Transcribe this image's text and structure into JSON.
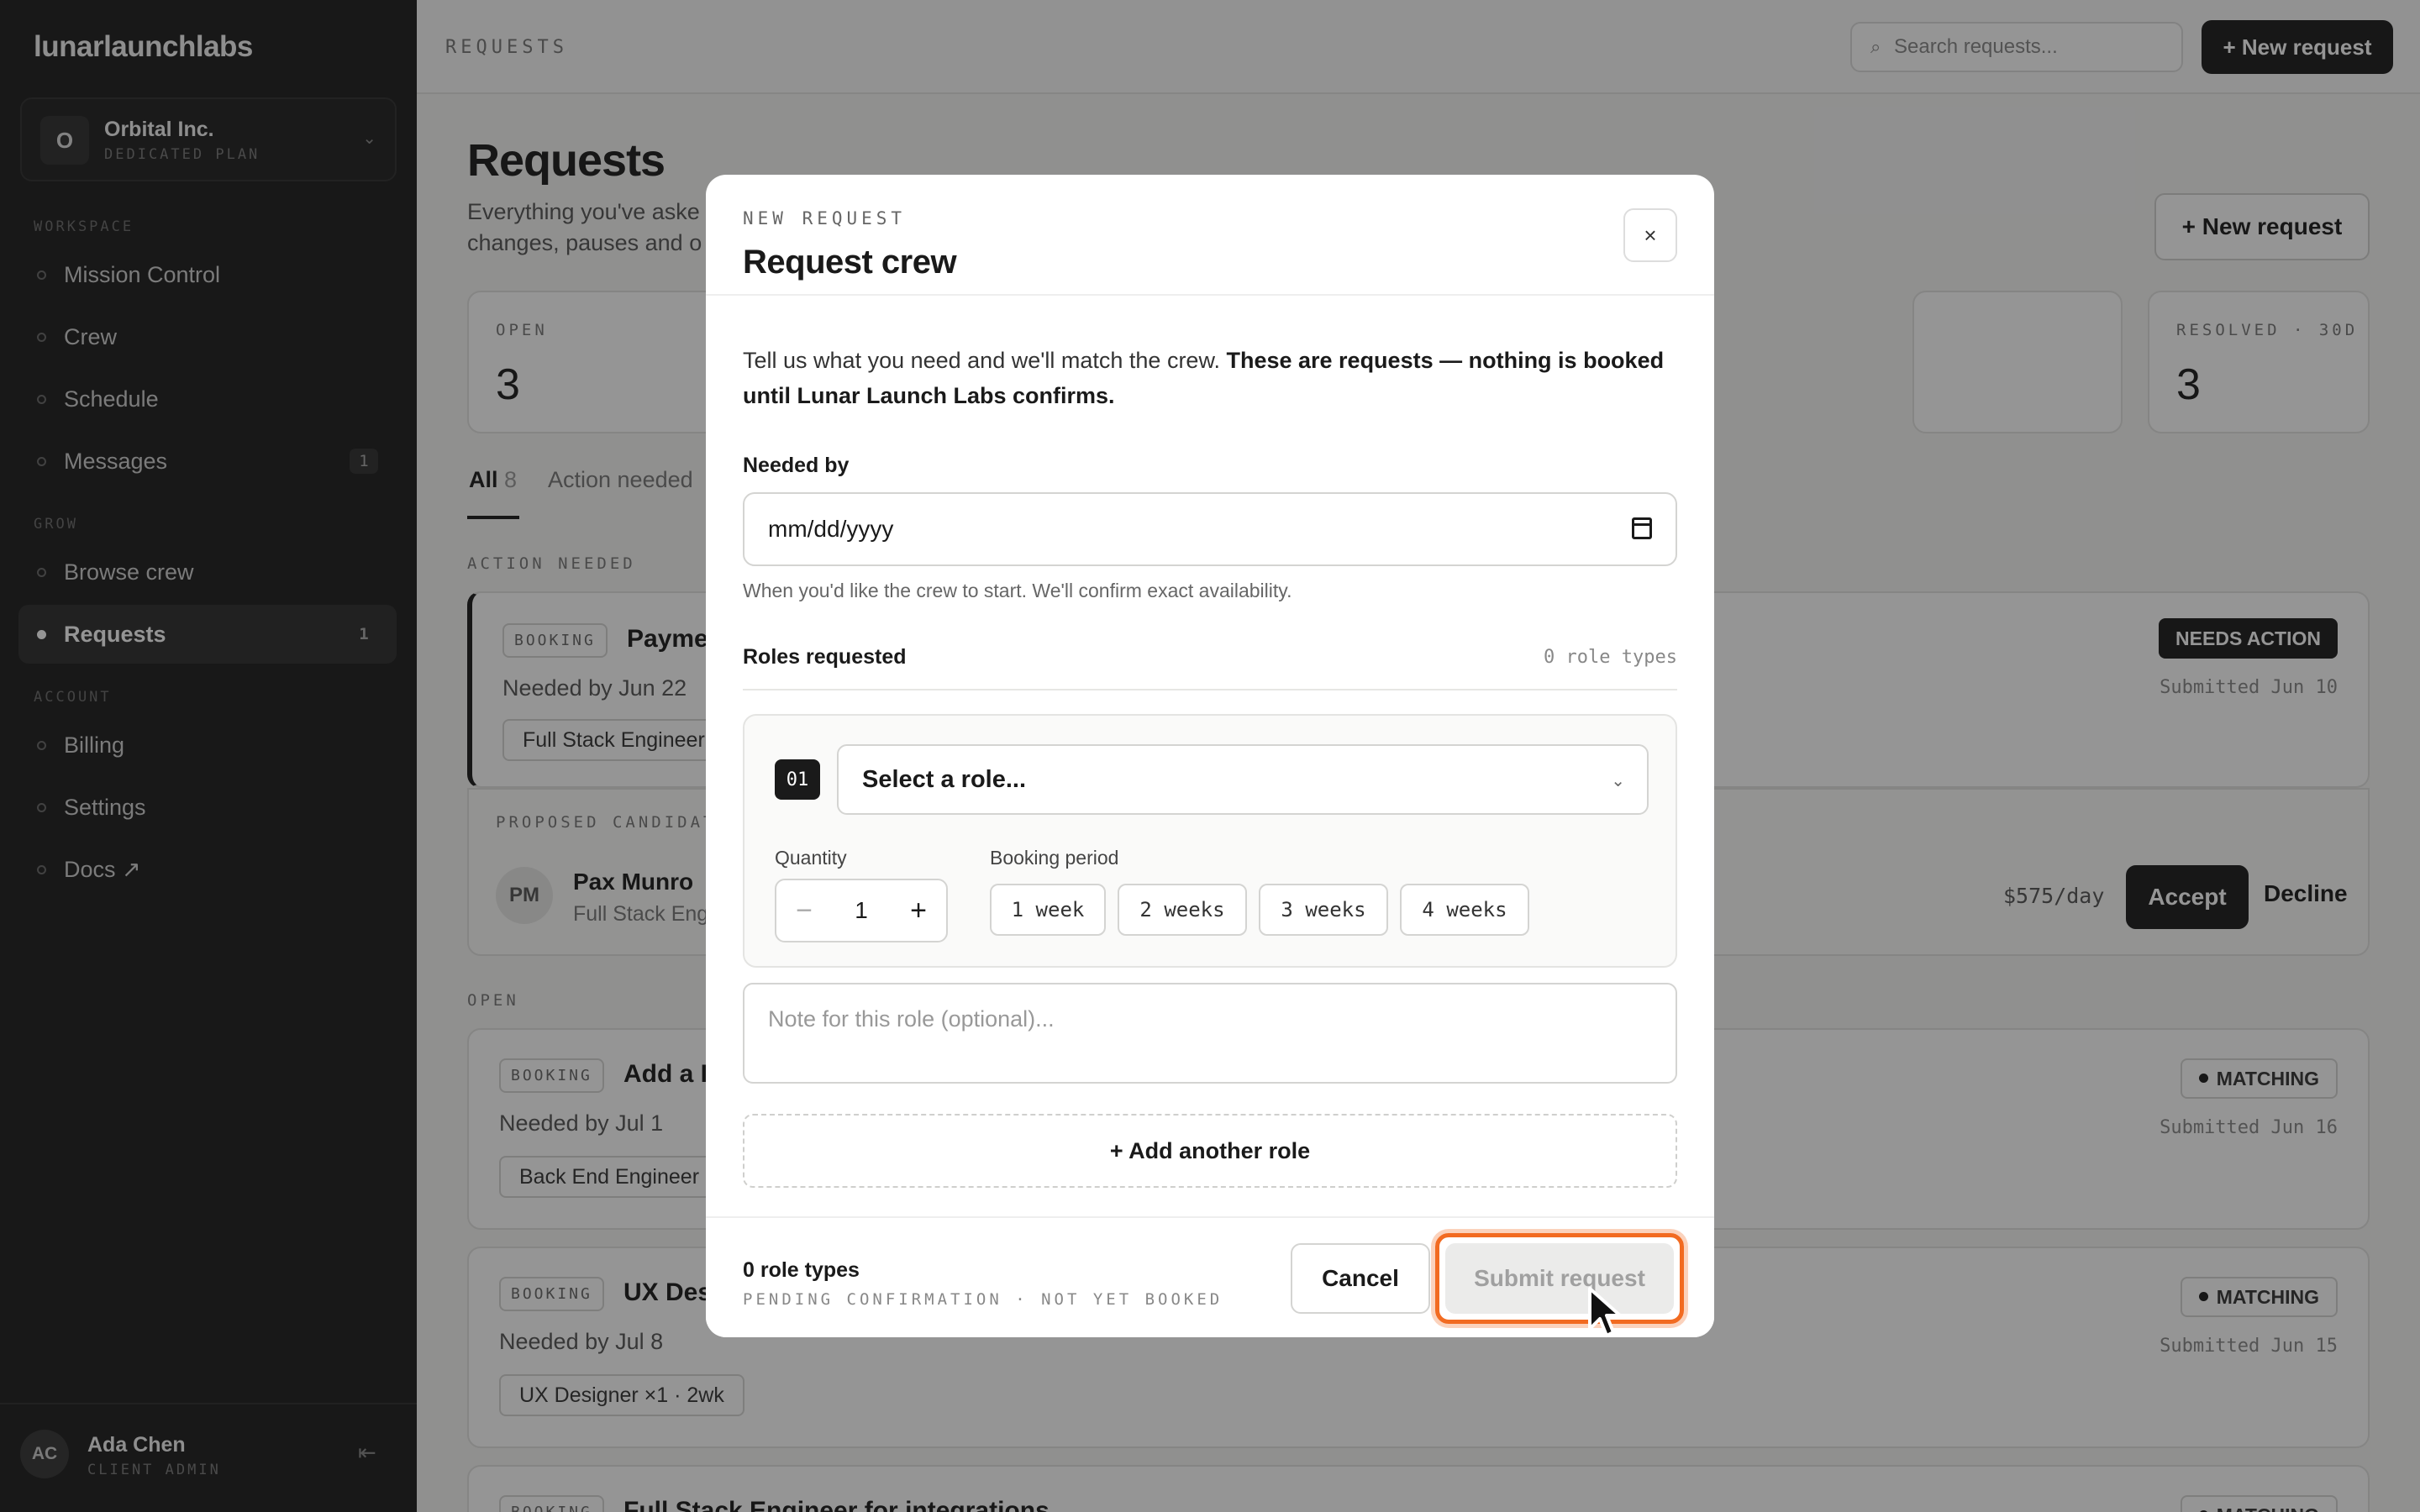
{
  "sidebar": {
    "logo": "lunarlaunchlabs",
    "org": {
      "initial": "O",
      "name": "Orbital Inc.",
      "plan": "DEDICATED PLAN"
    },
    "sections": {
      "workspace": "WORKSPACE",
      "grow": "GROW",
      "account": "ACCOUNT"
    },
    "items": [
      {
        "label": "Mission Control"
      },
      {
        "label": "Crew"
      },
      {
        "label": "Schedule"
      },
      {
        "label": "Messages",
        "count": "1"
      },
      {
        "label": "Browse crew"
      },
      {
        "label": "Requests",
        "count": "1"
      },
      {
        "label": "Billing"
      },
      {
        "label": "Settings"
      },
      {
        "label": "Docs ↗"
      }
    ],
    "user": {
      "initials": "AC",
      "name": "Ada Chen",
      "role": "CLIENT ADMIN"
    }
  },
  "topbar": {
    "breadcrumb": "REQUESTS",
    "search_placeholder": "Search requests...",
    "new_label": "+ New request"
  },
  "page": {
    "title": "Requests",
    "subtitle": "Everything you've aske changes, pauses and o",
    "new_label": "+ New request",
    "stats": [
      {
        "label": "OPEN",
        "value": "3"
      },
      {
        "label": "RESOLVED · 30D",
        "value": "3"
      }
    ],
    "tabs": [
      {
        "label": "All",
        "count": "8"
      },
      {
        "label": "Action needed"
      }
    ],
    "groups": {
      "action": "ACTION NEEDED",
      "open": "OPEN"
    },
    "cards": [
      {
        "tag": "BOOKING",
        "title": "Payme",
        "needed": "Needed by Jun 22",
        "chip": "Full Stack Engineer",
        "badge": "NEEDS ACTION",
        "submitted": "Submitted Jun 10"
      },
      {
        "tag": "BOOKING",
        "title": "Add a I",
        "needed": "Needed by Jul 1",
        "chip": "Back End Engineer",
        "badge": "MATCHING",
        "submitted": "Submitted Jun 16"
      },
      {
        "tag": "BOOKING",
        "title": "UX Des",
        "needed": "Needed by Jul 8",
        "chip": "UX Designer ×1 · 2wk",
        "badge": "MATCHING",
        "submitted": "Submitted Jun 15"
      },
      {
        "tag": "BOOKING",
        "title": "Full Stack Engineer for integrations",
        "badge": "MATCHING"
      }
    ],
    "proposed": {
      "label": "PROPOSED CANDIDAT",
      "initials": "PM",
      "name": "Pax Munro",
      "role": "Full Stack Eng",
      "rate": "$575/day",
      "accept": "Accept",
      "decline": "Decline"
    }
  },
  "modal": {
    "eyebrow": "NEW REQUEST",
    "title": "Request crew",
    "close_icon": "×",
    "intro_plain": "Tell us what you need and we'll match the crew. ",
    "intro_bold": "These are requests — nothing is booked until Lunar Launch Labs confirms.",
    "needed_label": "Needed by",
    "date_placeholder": "mm/dd/yyyy",
    "date_hint": "When you'd like the crew to start. We'll confirm exact availability.",
    "roles_label": "Roles requested",
    "roles_count": "0 role types",
    "role": {
      "number": "01",
      "select_placeholder": "Select a role...",
      "quantity_label": "Quantity",
      "quantity": "1",
      "period_label": "Booking period",
      "periods": [
        "1 week",
        "2 weeks",
        "3 weeks",
        "4 weeks"
      ]
    },
    "note_placeholder": "Note for this role (optional)...",
    "add_role": "+ Add another role",
    "footer_count": "0 role types",
    "footer_status": "PENDING CONFIRMATION · NOT YET BOOKED",
    "cancel": "Cancel",
    "submit": "Submit request"
  },
  "colors": {
    "accent": "#f26b21",
    "sidebar": "#1c1c1c",
    "primary": "#1a1a1a"
  }
}
